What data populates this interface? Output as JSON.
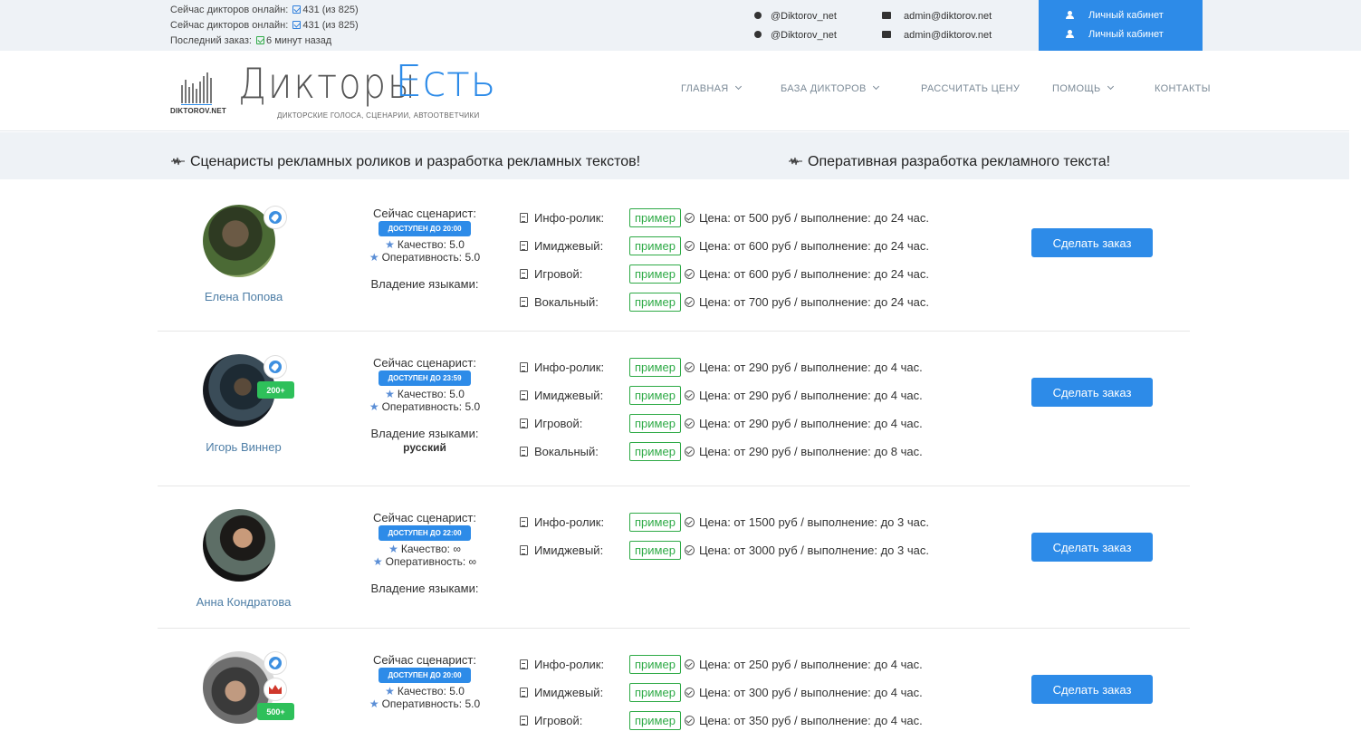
{
  "topbar": {
    "stats": [
      {
        "label": "Сейчас дикторов онлайн:",
        "value": "431 (из 825)"
      },
      {
        "label": "Сейчас дикторов онлайн:",
        "value": "431 (из 825)"
      },
      {
        "label": "Последний заказ:",
        "value": "6 минут назад"
      }
    ],
    "telegram": [
      "@Diktorov_net",
      "@Diktorov_net"
    ],
    "email": [
      "admin@diktorov.net",
      "admin@diktorov.net"
    ],
    "cabinet": [
      "Личный кабинет",
      "Личный кабинет"
    ]
  },
  "logo": {
    "site": "DIKTOROV.NET",
    "word1": "Дикторы",
    "word2": "Есть",
    "tagline": "ДИКТОРСКИЕ ГОЛОСА, СЦЕНАРИИ, АВТООТВЕТЧИКИ"
  },
  "nav": [
    "ГЛАВНАЯ",
    "БАЗА ДИКТОРОВ",
    "РАССЧИТАТЬ ЦЕНУ",
    "ПОМОЩЬ",
    "КОНТАКТЫ"
  ],
  "section": {
    "left_title": "Сценаристы рекламных роликов и разработка рекламных текстов!",
    "right_title": "Оперативная разработка рекламного текста!"
  },
  "labels": {
    "now": "Сейчас сценарист:",
    "quality": "Качество:",
    "speed": "Оперативность:",
    "languages": "Владение языками:",
    "example": "пример",
    "order": "Сделать заказ"
  },
  "writers": [
    {
      "name": "Елена Попова",
      "available": "ДОСТУПЕН ДО 20:00",
      "quality": "5.0",
      "speed": "5.0",
      "languages": "",
      "badge": "",
      "prices": [
        {
          "type": "Инфо-ролик:",
          "text": "Цена: от 500 руб / выполнение: до 24 час."
        },
        {
          "type": "Имиджевый:",
          "text": "Цена: от 600 руб / выполнение: до 24 час."
        },
        {
          "type": "Игровой:",
          "text": "Цена: от 600 руб / выполнение: до 24 час."
        },
        {
          "type": "Вокальный:",
          "text": "Цена: от 700 руб / выполнение: до 24 час."
        }
      ]
    },
    {
      "name": "Игорь Виннер",
      "available": "ДОСТУПЕН ДО 23:59",
      "quality": "5.0",
      "speed": "5.0",
      "languages": "русский",
      "badge": "200+",
      "prices": [
        {
          "type": "Инфо-ролик:",
          "text": "Цена: от 290 руб / выполнение: до 4 час."
        },
        {
          "type": "Имиджевый:",
          "text": "Цена: от 290 руб / выполнение: до 4 час."
        },
        {
          "type": "Игровой:",
          "text": "Цена: от 290 руб / выполнение: до 4 час."
        },
        {
          "type": "Вокальный:",
          "text": "Цена: от 290 руб / выполнение: до 8 час."
        }
      ]
    },
    {
      "name": "Анна Кондратова",
      "available": "ДОСТУПЕН ДО 22:00",
      "quality": "∞",
      "speed": "∞",
      "languages": "",
      "badge": "",
      "prices": [
        {
          "type": "Инфо-ролик:",
          "text": "Цена: от 1500 руб / выполнение: до 3 час."
        },
        {
          "type": "Имиджевый:",
          "text": "Цена: от 3000 руб / выполнение: до 3 час."
        }
      ]
    },
    {
      "name": "",
      "available": "ДОСТУПЕН ДО 20:00",
      "quality": "5.0",
      "speed": "5.0",
      "languages": "",
      "badge": "500+",
      "prices": [
        {
          "type": "Инфо-ролик:",
          "text": "Цена: от 250 руб / выполнение: до 4 час."
        },
        {
          "type": "Имиджевый:",
          "text": "Цена: от 300 руб / выполнение: до 4 час."
        },
        {
          "type": "Игровой:",
          "text": "Цена: от 350 руб / выполнение: до 4 час."
        }
      ]
    }
  ],
  "colors": {
    "accent": "#2d8be8",
    "green": "#2eaa46",
    "badge": "#2ec05a",
    "name": "#4e7ea6",
    "topbar": "#eef2f6"
  }
}
